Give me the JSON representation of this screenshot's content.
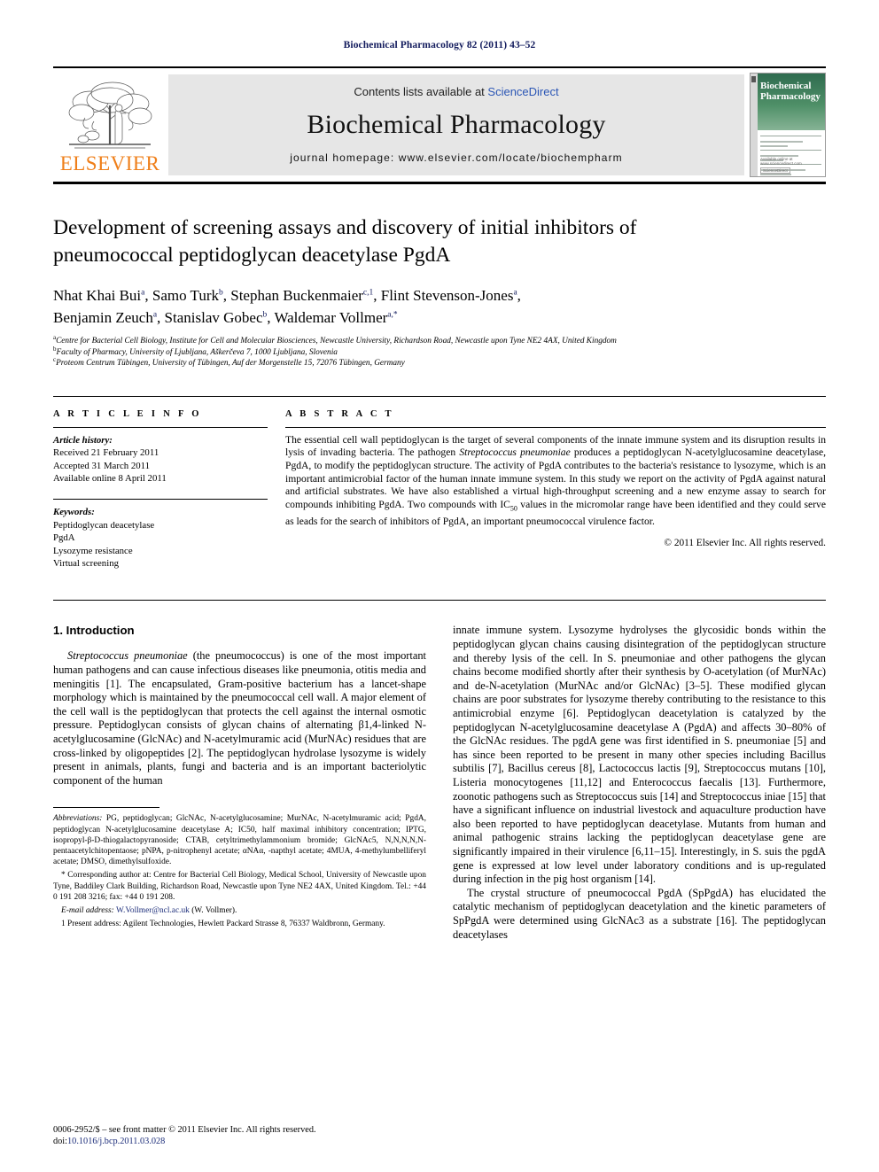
{
  "running_head": "Biochemical Pharmacology 82 (2011) 43–52",
  "masthead": {
    "publisher_logo_text": "ELSEVIER",
    "contents_prefix": "Contents lists available at ",
    "contents_link": "ScienceDirect",
    "journal_title": "Biochemical Pharmacology",
    "homepage": "journal homepage: www.elsevier.com/locate/biochempharm",
    "cover": {
      "title_line1": "Biochemical",
      "title_line2": "Pharmacology",
      "footer_text": "Available online at www.sciencedirect.com",
      "footer_badge": "ScienceDirect"
    }
  },
  "article": {
    "title": "Development of screening assays and discovery of initial inhibitors of pneumococcal peptidoglycan deacetylase PgdA",
    "authors_line1": [
      {
        "name": "Nhat Khai Bui",
        "marks": "a"
      },
      {
        "name": "Samo Turk",
        "marks": "b"
      },
      {
        "name": "Stephan Buckenmaier",
        "marks": "c,1"
      },
      {
        "name": "Flint Stevenson-Jones",
        "marks": "a"
      }
    ],
    "authors_line2": [
      {
        "name": "Benjamin Zeuch",
        "marks": "a"
      },
      {
        "name": "Stanislav Gobec",
        "marks": "b"
      },
      {
        "name": "Waldemar Vollmer",
        "marks": "a,*"
      }
    ],
    "affiliations": [
      {
        "mark": "a",
        "text": "Centre for Bacterial Cell Biology, Institute for Cell and Molecular Biosciences, Newcastle University, Richardson Road, Newcastle upon Tyne NE2 4AX, United Kingdom"
      },
      {
        "mark": "b",
        "text": "Faculty of Pharmacy, University of Ljubljana, Aškerčeva 7, 1000 Ljubljana, Slovenia"
      },
      {
        "mark": "c",
        "text": "Proteom Centrum Tübingen, University of Tübingen, Auf der Morgenstelle 15, 72076 Tübingen, Germany"
      }
    ]
  },
  "article_info": {
    "heading": "A R T I C L E  I N F O",
    "history_label": "Article history:",
    "history": [
      "Received 21 February 2011",
      "Accepted 31 March 2011",
      "Available online 8 April 2011"
    ],
    "keywords_label": "Keywords:",
    "keywords": [
      "Peptidoglycan deacetylase",
      "PgdA",
      "Lysozyme resistance",
      "Virtual screening"
    ]
  },
  "abstract": {
    "heading": "A B S T R A C T",
    "paragraph_part1": "The essential cell wall peptidoglycan is the target of several components of the innate immune system and its disruption results in lysis of invading bacteria. The pathogen ",
    "species1": "Streptococcus pneumoniae",
    "paragraph_part2": " produces a peptidoglycan N-acetylglucosamine deacetylase, PgdA, to modify the peptidoglycan structure. The activity of PgdA contributes to the bacteria's resistance to lysozyme, which is an important antimicrobial factor of the human innate immune system. In this study we report on the activity of PgdA against natural and artificial substrates. We have also established a virtual high-throughput screening and a new enzyme assay to search for compounds inhibiting PgdA. Two compounds with IC",
    "subscript": "50",
    "paragraph_part3": " values in the micromolar range have been identified and they could serve as leads for the search of inhibitors of PgdA, an important pneumococcal virulence factor.",
    "copyright": "© 2011 Elsevier Inc. All rights reserved."
  },
  "introduction": {
    "heading": "1. Introduction",
    "left_paragraph_species": "Streptococcus pneumoniae",
    "left_paragraph": " (the pneumococcus) is one of the most important human pathogens and can cause infectious diseases like pneumonia, otitis media and meningitis [1]. The encapsulated, Gram-positive bacterium has a lancet-shape morphology which is maintained by the pneumococcal cell wall. A major element of the cell wall is the peptidoglycan that protects the cell against the internal osmotic pressure. Peptidoglycan consists of glycan chains of alternating β1,4-linked N-acetylglucosamine (GlcNAc) and N-acetylmuramic acid (MurNAc) residues that are cross-linked by oligopeptides [2]. The peptidoglycan hydrolase lysozyme is widely present in animals, plants, fungi and bacteria and is an important bacteriolytic component of the human",
    "right_paragraph_1": "innate immune system. Lysozyme hydrolyses the glycosidic bonds within the peptidoglycan glycan chains causing disintegration of the peptidoglycan structure and thereby lysis of the cell. In S. pneumoniae and other pathogens the glycan chains become modified shortly after their synthesis by O-acetylation (of MurNAc) and de-N-acetylation (MurNAc and/or GlcNAc) [3–5]. These modified glycan chains are poor substrates for lysozyme thereby contributing to the resistance to this antimicrobial enzyme [6]. Peptidoglycan deacetylation is catalyzed by the peptidoglycan N-acetylglucosamine deacetylase A (PgdA) and affects 30–80% of the GlcNAc residues. The pgdA gene was first identified in S. pneumoniae [5] and has since been reported to be present in many other species including Bacillus subtilis [7], Bacillus cereus [8], Lactococcus lactis [9], Streptococcus mutans [10], Listeria monocytogenes [11,12] and Enterococcus faecalis [13]. Furthermore, zoonotic pathogens such as Streptococcus suis [14] and Streptococcus iniae [15] that have a significant influence on industrial livestock and aquaculture production have also been reported to have peptidoglycan deacetylase. Mutants from human and animal pathogenic strains lacking the peptidoglycan deacetylase gene are significantly impaired in their virulence [6,11–15]. Interestingly, in S. suis the pgdA gene is expressed at low level under laboratory conditions and is up-regulated during infection in the pig host organism [14].",
    "right_paragraph_2": "The crystal structure of pneumococcal PgdA (SpPgdA) has elucidated the catalytic mechanism of peptidoglycan deacetylation and the kinetic parameters of SpPgdA were determined using GlcNAc3 as a substrate [16]. The peptidoglycan deacetylases"
  },
  "footnotes": {
    "abbreviations_label": "Abbreviations:",
    "abbreviations_text": " PG, peptidoglycan; GlcNAc, N-acetylglucosamine; MurNAc, N-acetylmuramic acid; PgdA, peptidoglycan N-acetylglucosamine deacetylase A; IC50, half maximal inhibitory concentration; IPTG, isopropyl-β-D-thiogalactopyranoside; CTAB, cetyltrimethylammonium bromide; GlcNAc5, N,N,N,N,N-pentaacetylchitopentaose; pNPA, p-nitrophenyl acetate; αNAα, -napthyl acetate; 4MUA, 4-methylumbelliferyl acetate; DMSO, dimethylsulfoxide.",
    "corresponding": "* Corresponding author at: Centre for Bacterial Cell Biology, Medical School, University of Newcastle upon Tyne, Baddiley Clark Building, Richardson Road, Newcastle upon Tyne NE2 4AX, United Kingdom. Tel.: +44 0 191 208 3216; fax: +44 0 191 208.",
    "email_label": "E-mail address:",
    "email": "W.Vollmer@ncl.ac.uk",
    "email_suffix": " (W. Vollmer).",
    "present_address": "1 Present address: Agilent Technologies, Hewlett Packard Strasse 8, 76337 Waldbronn, Germany."
  },
  "imprint": {
    "line1": "0006-2952/$ – see front matter © 2011 Elsevier Inc. All rights reserved.",
    "doi_label": "doi:",
    "doi": "10.1016/j.bcp.2011.03.028"
  },
  "colors": {
    "link_blue": "#2b56b5",
    "ref_blue": "#1c2d7a",
    "elsevier_orange": "#ef7f1a",
    "cover_green": "#2f6b4f"
  }
}
